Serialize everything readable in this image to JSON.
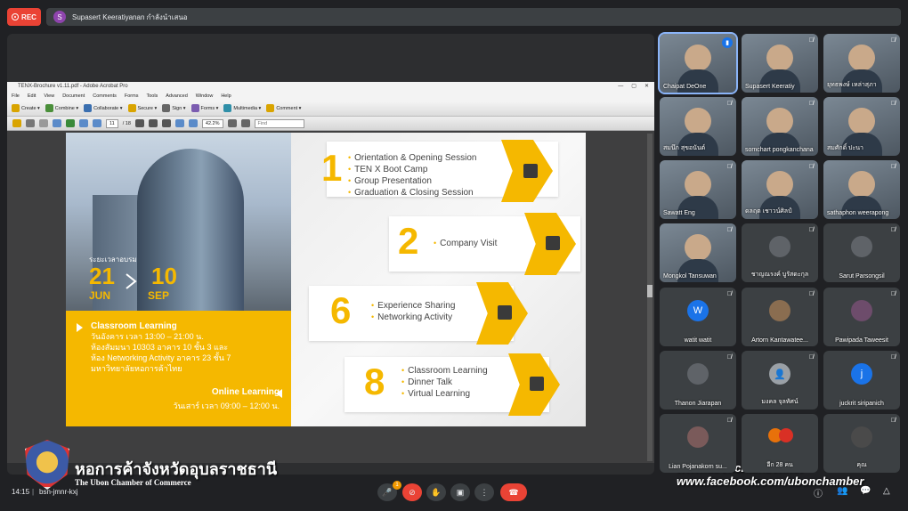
{
  "recording": {
    "label": "REC"
  },
  "presenter": {
    "avatar_letter": "S",
    "text": "Supasert Keeratiyanan กำลังนำเสนอ"
  },
  "acrobat": {
    "title": "TENX-Brochure v1.11.pdf - Adobe Acrobat Pro",
    "window_controls": [
      "—",
      "▢",
      "✕"
    ],
    "menu": [
      "File",
      "Edit",
      "View",
      "Document",
      "Comments",
      "Forms",
      "Tools",
      "Advanced",
      "Window",
      "Help"
    ],
    "toolbar": [
      "Create ▾",
      "Combine ▾",
      "Collaborate ▾",
      "Secure ▾",
      "Sign ▾",
      "Forms ▾",
      "Multimedia ▾",
      "Comment ▾"
    ],
    "page_current": "11",
    "page_total": "/ 18",
    "zoom": "42.2%",
    "find_placeholder": "Find"
  },
  "brochure": {
    "date_label": "ระยะเวลาอบรม",
    "date_start": "21",
    "month_start": "JUN",
    "date_end": "10",
    "month_end": "SEP",
    "classroom_title": "Classroom Learning",
    "classroom_lines": [
      "วันอังคาร เวลา 13:00 – 21:00 น.",
      "ห้องสัมมนา 10303 อาคาร 10 ชั้น 3 และ",
      "ห้อง Networking Activity อาคาร 23 ชั้น 7",
      "มหาวิทยาลัยหอการค้าไทย"
    ],
    "online_title": "Online Learning",
    "online_time": "วันเสาร์ เวลา 09:00 – 12:00 น.",
    "sections": [
      {
        "number": "1",
        "items": [
          "Orientation & Opening Session",
          "TEN X Boot Camp",
          "Group Presentation",
          "Graduation & Closing Session"
        ]
      },
      {
        "number": "2",
        "items": [
          "Company Visit"
        ]
      },
      {
        "number": "6",
        "items": [
          "Experience Sharing",
          "Networking Activity"
        ]
      },
      {
        "number": "8",
        "items": [
          "Classroom Learning",
          "Dinner Talk",
          "Virtual Learning"
        ]
      }
    ]
  },
  "watermark": {
    "chamber_thai": "หอการค้าจังหวัดอุบลราชธานี",
    "chamber_en": "The Ubon Chamber of Commerce",
    "website": "www.ubonchamber.net",
    "facebook": "www.facebook.com/ubonchamber"
  },
  "participants": [
    {
      "name": "Chaipat DeOne",
      "type": "video",
      "speaking": true
    },
    {
      "name": "Supasert Keeratiy",
      "type": "video"
    },
    {
      "name": "ยุทธพงษ์ เหล่าสุภา",
      "type": "video"
    },
    {
      "name": "สมนึก สุขอนันต์",
      "type": "video"
    },
    {
      "name": "somchart pongkanchana",
      "type": "video"
    },
    {
      "name": "สมศักดิ์ ปะนา",
      "type": "video"
    },
    {
      "name": "Sawatt Eng",
      "type": "video"
    },
    {
      "name": "ดลฤต เชาวน์ศิลป์",
      "type": "video"
    },
    {
      "name": "sathaphon weerapong",
      "type": "video"
    },
    {
      "name": "Mongkol Tansuwan",
      "type": "video"
    },
    {
      "name": "ชาญณรงค์ บูรัสดะกุล",
      "type": "avatar",
      "avatar_color": "#5f6368",
      "avatar_letter": ""
    },
    {
      "name": "Sarut Parsongsil",
      "type": "avatar",
      "avatar_color": "#5f6368",
      "avatar_letter": ""
    },
    {
      "name": "watit watit",
      "type": "avatar",
      "avatar_color": "#1a73e8",
      "avatar_letter": "W"
    },
    {
      "name": "Artorn Kantawatee...",
      "type": "avatar",
      "avatar_color": "#8a6d50",
      "avatar_letter": ""
    },
    {
      "name": "Pawipada Taweesit",
      "type": "avatar",
      "avatar_color": "#6d4c6b",
      "avatar_letter": ""
    },
    {
      "name": "Thanon Jiarapan",
      "type": "avatar",
      "avatar_color": "#5f6368",
      "avatar_letter": ""
    },
    {
      "name": "มงคล จุลทัศน์",
      "type": "avatar",
      "avatar_color": "#9aa0a6",
      "avatar_letter": "👤"
    },
    {
      "name": "juckrit siripanich",
      "type": "avatar",
      "avatar_color": "#1a73e8",
      "avatar_letter": "j"
    },
    {
      "name": "Lian Pojanakorn su...",
      "type": "avatar",
      "avatar_color": "#7a5a5a",
      "avatar_letter": ""
    },
    {
      "name": "อีก 28 คน",
      "type": "others"
    },
    {
      "name": "คุณ",
      "type": "avatar",
      "avatar_color": "#4a4a4a",
      "avatar_letter": ""
    }
  ],
  "bottom": {
    "time": "14:15",
    "separator": "|",
    "meeting_code": "bsn-jmnr-kxj",
    "participant_count_badge": "1"
  },
  "colors": {
    "brand_yellow": "#f5b800",
    "meet_bg": "#202124",
    "danger": "#ea4335",
    "accent": "#1a73e8"
  }
}
